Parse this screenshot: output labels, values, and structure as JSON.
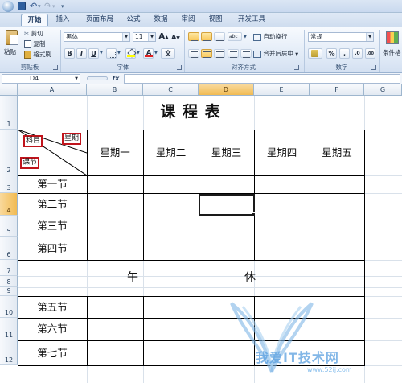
{
  "quick_access": {
    "dropdown_glyph": "▾",
    "undo_glyph": "↶",
    "redo_glyph": "↷"
  },
  "tabs": [
    {
      "label": "开始",
      "active": true
    },
    {
      "label": "插入"
    },
    {
      "label": "页面布局"
    },
    {
      "label": "公式"
    },
    {
      "label": "数据"
    },
    {
      "label": "审阅"
    },
    {
      "label": "视图"
    },
    {
      "label": "开发工具"
    }
  ],
  "ribbon": {
    "clipboard": {
      "paste": "粘贴",
      "cut": "剪切",
      "copy": "复制",
      "format_painter": "格式刷",
      "label": "剪贴板"
    },
    "font": {
      "font_name": "黑体",
      "font_size": "11",
      "grow": "A",
      "shrink": "A",
      "bold": "B",
      "italic": "I",
      "underline": "U",
      "font_color": "A",
      "label": "字体",
      "ab_text": "abc",
      "wen": "文",
      "fill_color": "#ffff00",
      "text_color": "#e02020"
    },
    "alignment": {
      "wrap_text": "自动换行",
      "merge_center": "合并后居中",
      "label": "对齐方式"
    },
    "number": {
      "format": "常规",
      "percent": "%",
      "comma": ",",
      "inc": ".0",
      "dec": ".00",
      "label": "数字"
    },
    "styles": {
      "conditional": "条件格"
    }
  },
  "formula_bar": {
    "cell_ref": "D4",
    "fx": "fx",
    "value": ""
  },
  "sheet": {
    "columns": [
      "A",
      "B",
      "C",
      "D",
      "E",
      "F",
      "G"
    ],
    "selected_column": "D",
    "rows": [
      "1",
      "2",
      "3",
      "4",
      "5",
      "6",
      "7",
      "8",
      "9",
      "10",
      "11",
      "12"
    ],
    "selected_row": "4",
    "title": "课 程 表",
    "diag": {
      "top_right": "星期",
      "middle_left": "科目",
      "bottom_left": "课节"
    },
    "weekdays": [
      "星期一",
      "星期二",
      "星期三",
      "星期四",
      "星期五"
    ],
    "periods_morning": [
      "第一节",
      "第二节",
      "第三节",
      "第四节"
    ],
    "lunch_left": "午",
    "lunch_right": "休",
    "periods_afternoon": [
      "第五节",
      "第六节",
      "第七节"
    ]
  },
  "watermark": {
    "text": "我爱IT技术网",
    "url": "www.52ij.com"
  }
}
